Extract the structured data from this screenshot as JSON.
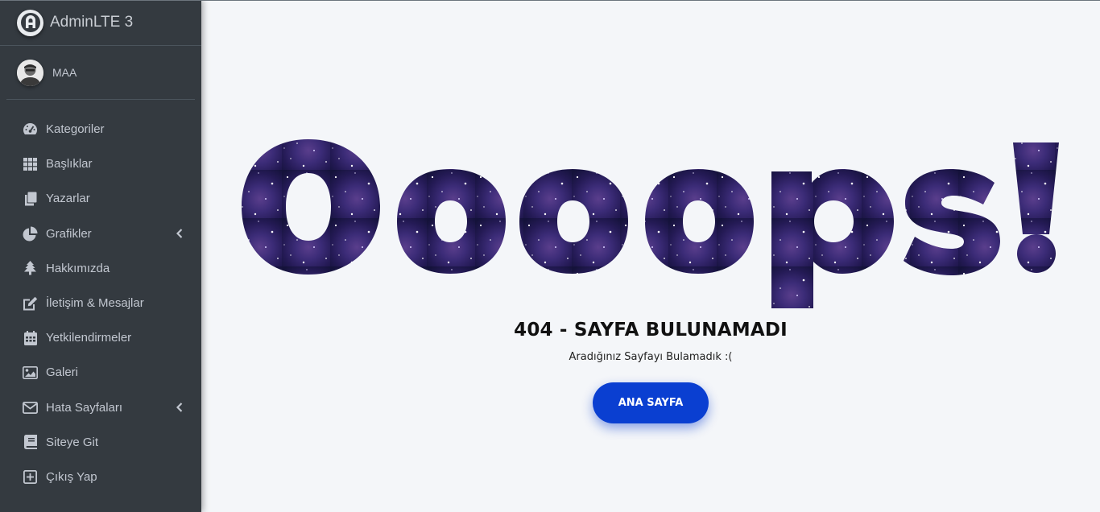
{
  "brand": {
    "name": "AdminLTE 3",
    "icon": "adminlte-logo"
  },
  "user": {
    "name": "MAA",
    "icon": "user-avatar"
  },
  "sidebar": {
    "items": [
      {
        "label": "Kategoriler",
        "icon": "tachometer-icon",
        "has_submenu": false
      },
      {
        "label": "Başlıklar",
        "icon": "grid-icon",
        "has_submenu": false
      },
      {
        "label": "Yazarlar",
        "icon": "copy-icon",
        "has_submenu": false
      },
      {
        "label": "Grafikler",
        "icon": "pie-chart-icon",
        "has_submenu": true
      },
      {
        "label": "Hakkımızda",
        "icon": "tree-icon",
        "has_submenu": false
      },
      {
        "label": "İletişim & Mesajlar",
        "icon": "edit-icon",
        "has_submenu": false
      },
      {
        "label": "Yetkilendirmeler",
        "icon": "calendar-icon",
        "has_submenu": false
      },
      {
        "label": "Galeri",
        "icon": "image-icon",
        "has_submenu": false
      },
      {
        "label": "Hata Sayfaları",
        "icon": "envelope-icon",
        "has_submenu": true
      },
      {
        "label": "Siteye Git",
        "icon": "book-icon",
        "has_submenu": false
      },
      {
        "label": "Çıkış Yap",
        "icon": "plus-square-icon",
        "has_submenu": false
      }
    ]
  },
  "error": {
    "headline": "Oooops!",
    "title": "404 - SAYFA BULUNAMADI",
    "subtitle": "Aradığınız Sayfayı Bulamadık :(",
    "button": "ANA SAYFA"
  },
  "colors": {
    "sidebar_bg": "#343a40",
    "content_bg": "#f4f6f9",
    "button_bg": "#0a3fd1",
    "headline_fill": "#2e1f5e"
  }
}
